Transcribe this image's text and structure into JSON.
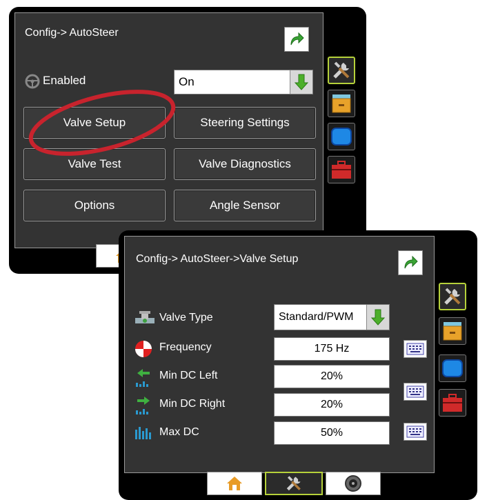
{
  "screen1": {
    "title": "Config-> AutoSteer",
    "enabled_label": "Enabled",
    "enabled_value": "On",
    "buttons": {
      "valve_setup": "Valve Setup",
      "steering_settings": "Steering Settings",
      "valve_test": "Valve Test",
      "valve_diagnostics": "Valve Diagnostics",
      "options": "Options",
      "angle_sensor": "Angle Sensor"
    },
    "highlight_color": "#c8232d"
  },
  "screen2": {
    "title": "Config-> AutoSteer->Valve Setup",
    "rows": {
      "valve_type": {
        "label": "Valve Type",
        "value": "Standard/PWM"
      },
      "frequency": {
        "label": "Frequency",
        "value": "175 Hz"
      },
      "min_dc_left": {
        "label": "Min DC Left",
        "value": "20%"
      },
      "min_dc_right": {
        "label": "Min DC Right",
        "value": "20%"
      },
      "max_dc": {
        "label": "Max DC",
        "value": "50%"
      }
    }
  },
  "icons": {
    "back": "back-arrow-icon",
    "dropdown": "green-down-arrow-icon",
    "keyboard": "keyboard-icon",
    "tools": "tools-icon",
    "files": "file-cabinet-icon",
    "console": "console-icon",
    "toolbox": "toolbox-icon",
    "home": "home-icon",
    "gauge": "gauge-icon"
  },
  "colors": {
    "accent": "#b6d23a",
    "green": "#4caf2a",
    "panel": "#333333"
  }
}
